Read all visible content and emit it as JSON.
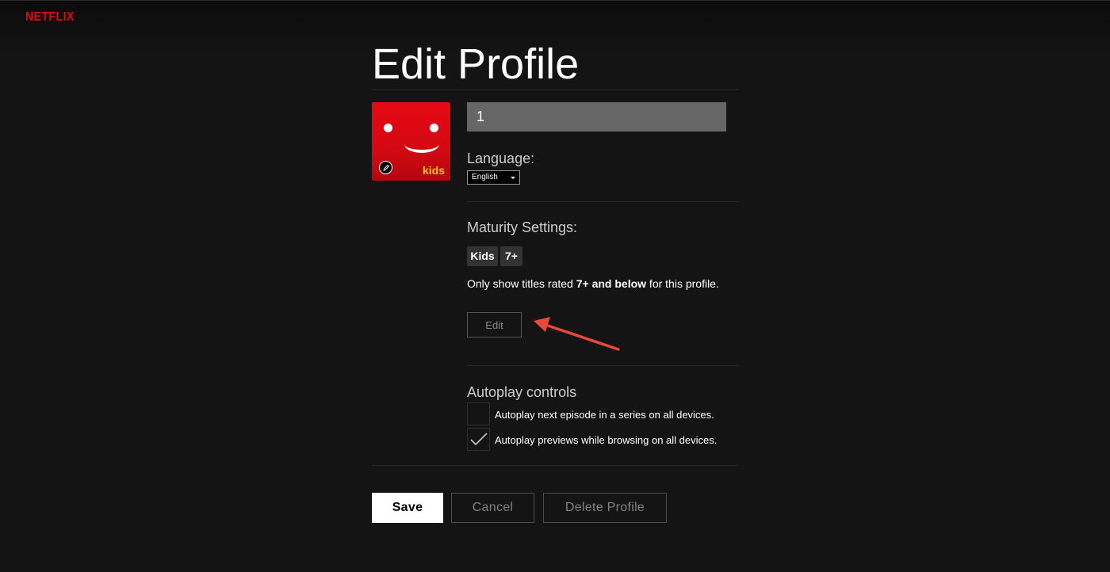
{
  "header": {
    "logo_text": "NETFLIX"
  },
  "page": {
    "title": "Edit Profile"
  },
  "profile": {
    "name_value": "1",
    "avatar_badge": "kids"
  },
  "language": {
    "label": "Language:",
    "selected": "English"
  },
  "maturity": {
    "label": "Maturity Settings:",
    "badges": [
      "Kids",
      "7+"
    ],
    "description_prefix": "Only show titles rated ",
    "description_bold": "7+ and below",
    "description_suffix": " for this profile.",
    "edit_label": "Edit"
  },
  "autoplay": {
    "label": "Autoplay controls",
    "options": [
      {
        "label": "Autoplay next episode in a series on all devices.",
        "checked": false
      },
      {
        "label": "Autoplay previews while browsing on all devices.",
        "checked": true
      }
    ]
  },
  "actions": {
    "save": "Save",
    "cancel": "Cancel",
    "delete": "Delete Profile"
  },
  "colors": {
    "brand": "#e50914",
    "background": "#141414",
    "annotation_arrow": "#e8473b"
  }
}
